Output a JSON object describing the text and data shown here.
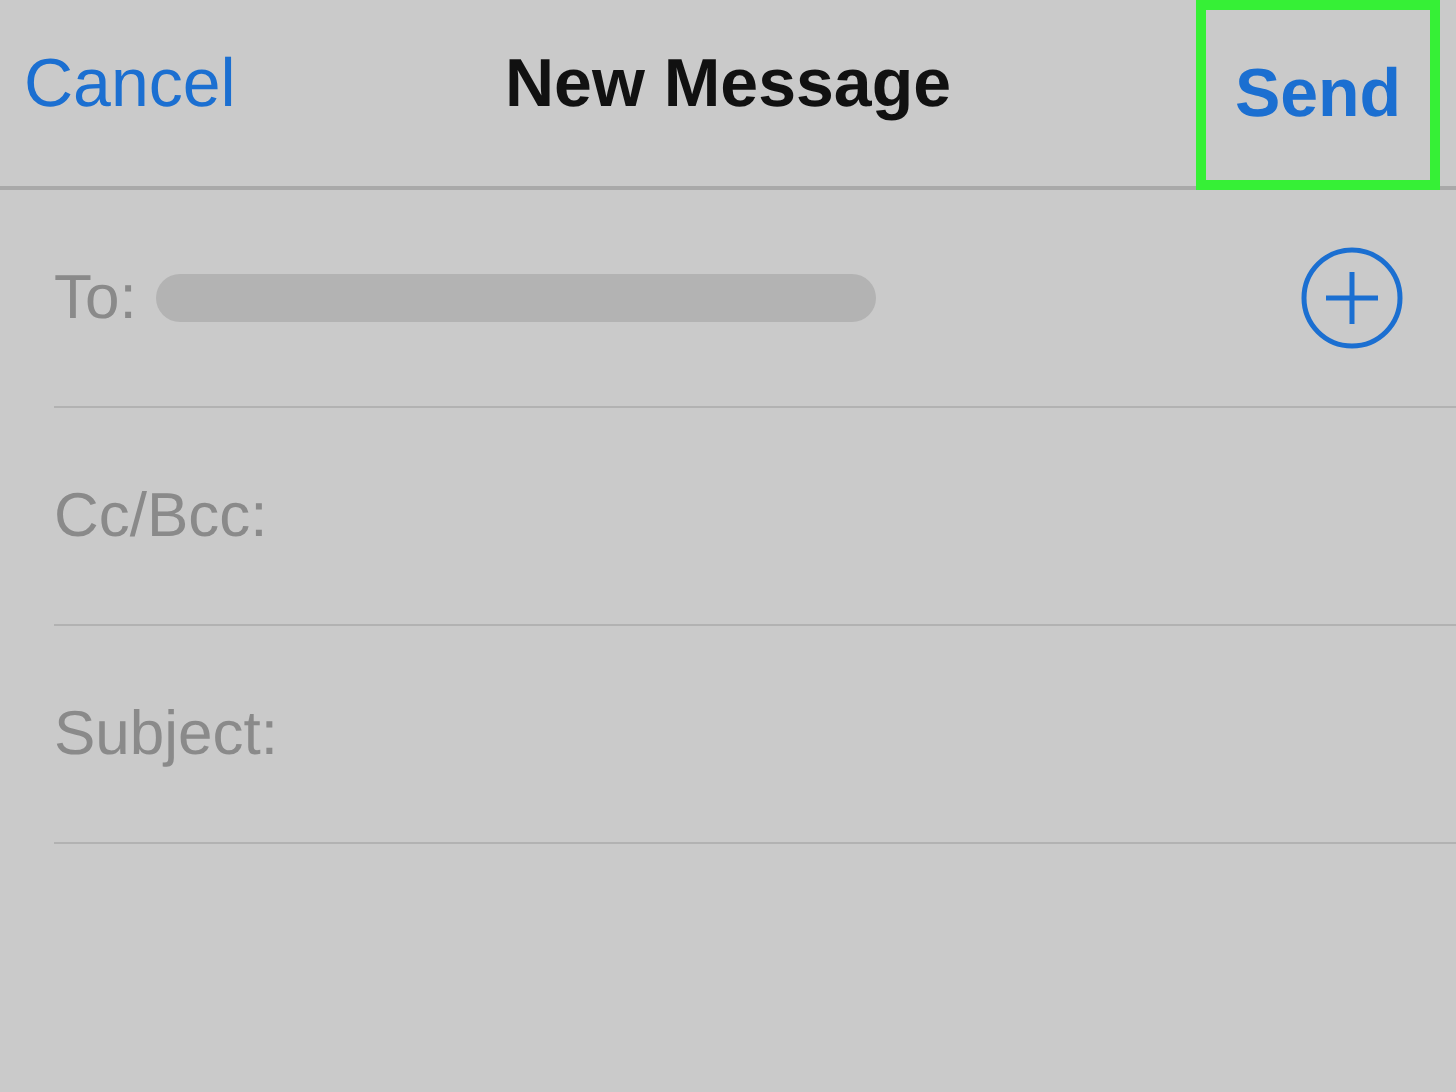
{
  "nav": {
    "cancel": "Cancel",
    "title": "New Message",
    "send": {
      "label": "Send",
      "highlighted": true
    }
  },
  "fields": [
    {
      "kind": "recipient",
      "label": "To:"
    },
    {
      "kind": "plain",
      "label": "Cc/Bcc:"
    },
    {
      "kind": "plain",
      "label": "Subject:"
    }
  ]
}
